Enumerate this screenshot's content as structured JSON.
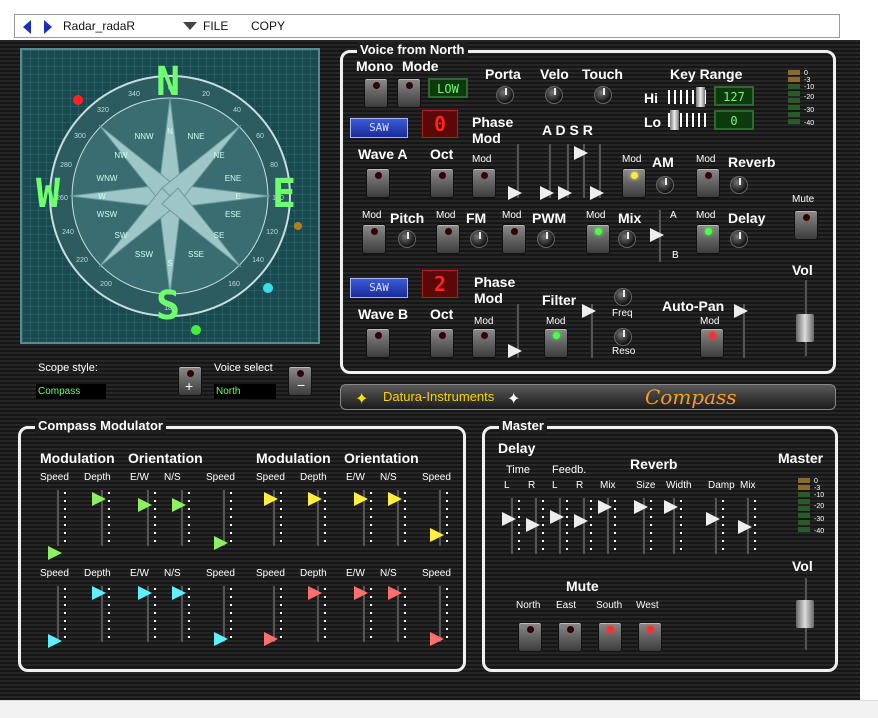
{
  "toolbar": {
    "title": "Radar_radaR",
    "file_label": "FILE",
    "copy_label": "COPY"
  },
  "radar": {
    "letters": {
      "n": "N",
      "s": "S",
      "e": "E",
      "w": "W"
    },
    "rose": [
      "N",
      "NNE",
      "NE",
      "ENE",
      "E",
      "ESE",
      "SE",
      "SSE",
      "S",
      "SSW",
      "SW",
      "WSW",
      "W",
      "WNW",
      "NW",
      "NNW"
    ],
    "ring_numbers": [
      "20",
      "40",
      "60",
      "80",
      "100",
      "120",
      "140",
      "160",
      "180",
      "200",
      "220",
      "240",
      "260",
      "280",
      "300",
      "320",
      "340",
      "0"
    ]
  },
  "scope": {
    "style_label": "Scope style:",
    "style_value": "Compass",
    "voice_label": "Voice select",
    "voice_value": "North",
    "plus_icon": "plus-icon",
    "minus_icon": "minus-icon"
  },
  "voice": {
    "title": "Voice from North",
    "mono_mode": "Mono",
    "mode": "Mode",
    "low": "LOW",
    "porta": "Porta",
    "velo": "Velo",
    "touch": "Touch",
    "key_range": "Key Range",
    "hi": "Hi",
    "lo": "Lo",
    "hi_value": "127",
    "lo_value": "0",
    "wave_a_display": "SAW",
    "wave_a": "Wave A",
    "oct_a_display": "0",
    "oct": "Oct",
    "phase_mod": "Phase Mod",
    "phase": "Phase",
    "mod": "Mod",
    "adsr": "A D S R",
    "am": "AM",
    "reverb": "Reverb",
    "pitch": "Pitch",
    "fm": "FM",
    "pwm": "PWM",
    "mix": "Mix",
    "a": "A",
    "b": "B",
    "delay": "Delay",
    "mute": "Mute",
    "vol": "Vol",
    "wave_b_display": "SAW",
    "wave_b": "Wave B",
    "oct_b_display": "2",
    "filter": "Filter",
    "freq": "Freq",
    "reso": "Reso",
    "auto_pan": "Auto-Pan",
    "meter_labels": [
      "0",
      "-3",
      "-10",
      "-20",
      "-30",
      "-40"
    ]
  },
  "brand": {
    "maker": "Datura-Instruments",
    "name": "Compass"
  },
  "modulator": {
    "title": "Compass Modulator",
    "groups": [
      "Modulation",
      "Orientation",
      "Modulation",
      "Orientation"
    ],
    "row_labels": [
      "Speed",
      "Depth",
      "E/W",
      "N/S",
      "Speed",
      "Speed",
      "Depth",
      "E/W",
      "N/S",
      "Speed"
    ],
    "row1_colors": [
      "g",
      "g",
      "g",
      "g",
      "g",
      "y",
      "y",
      "y",
      "y",
      "y"
    ],
    "row2_colors": [
      "c",
      "c",
      "c",
      "c",
      "c",
      "r",
      "r",
      "r",
      "r",
      "r"
    ]
  },
  "master": {
    "title": "Master",
    "delay": "Delay",
    "time": "Time",
    "feedb": "Feedb.",
    "reverb": "Reverb",
    "master": "Master",
    "labels": [
      "L",
      "R",
      "L",
      "R",
      "Mix",
      "Size",
      "Width",
      "Damp",
      "Mix"
    ],
    "mute": "Mute",
    "mute_labels": [
      "North",
      "East",
      "South",
      "West"
    ],
    "vol": "Vol"
  }
}
